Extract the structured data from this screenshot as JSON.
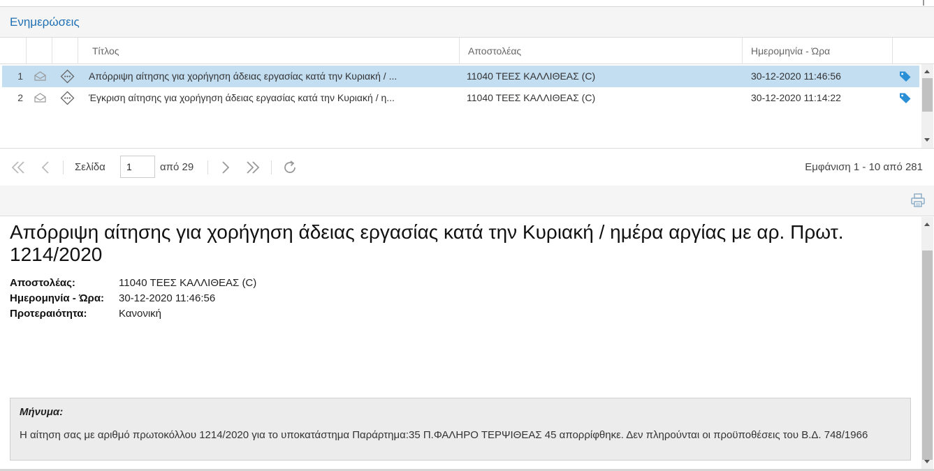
{
  "panel": {
    "title": "Ενημερώσεις"
  },
  "grid": {
    "columns": {
      "title": "Τίτλος",
      "sender": "Αποστολέας",
      "datetime": "Ημερομηνία - Ώρα"
    },
    "rows": [
      {
        "num": "1",
        "title": "Απόρριψη αίτησης για χορήγηση άδειας εργασίας κατά την Κυριακή / ...",
        "sender": "11040 ΤΕΕΣ ΚΑΛΛΙΘΕΑΣ (C)",
        "datetime": "30-12-2020 11:46:56",
        "selected": true
      },
      {
        "num": "2",
        "title": "Έγκριση αίτησης για χορήγηση άδειας εργασίας κατά την Κυριακή / η...",
        "sender": "11040 ΤΕΕΣ ΚΑΛΛΙΘΕΑΣ (C)",
        "datetime": "30-12-2020 11:14:22",
        "selected": false
      }
    ]
  },
  "pager": {
    "page_label": "Σελίδα",
    "page_value": "1",
    "of_label": "από 29",
    "display_info": "Εμφάνιση 1 - 10 από 281"
  },
  "detail": {
    "title": "Απόρριψη αίτησης για χορήγηση άδειας εργασίας κατά την Κυριακή / ημέρα αργίας με αρ. Πρωτ. 1214/2020",
    "sender_label": "Αποστολέας:",
    "sender_value": "11040 ΤΕΕΣ ΚΑΛΛΙΘΕΑΣ (C)",
    "datetime_label": "Ημερομηνία - Ώρα:",
    "datetime_value": "30-12-2020 11:46:56",
    "priority_label": "Προτεραιότητα:",
    "priority_value": "Κανονική",
    "message_label": "Μήνυμα:",
    "message_body": "Η αίτηση σας με αριθμό πρωτοκόλλου 1214/2020 για το υποκατάστημα Παράρτημα:35 Π.ΦΑΛΗΡΟ ΤΕΡΨΙΘΕΑΣ 45 απορρίφθηκε. Δεν πληρούνται οι προϋποθέσεις του Β.Δ. 748/1966"
  },
  "icons": {
    "row_envelope": "envelope-icon",
    "row_info": "info-ellipsis-icon",
    "row_tag": "tag-icon",
    "pager_first": "first-page-icon",
    "pager_prev": "prev-page-icon",
    "pager_next": "next-page-icon",
    "pager_last": "last-page-icon",
    "pager_refresh": "refresh-icon",
    "print": "print-icon"
  },
  "colors": {
    "accent": "#1e6fb3",
    "selected_row": "#c3ddf1",
    "tag": "#2b8fd6"
  }
}
